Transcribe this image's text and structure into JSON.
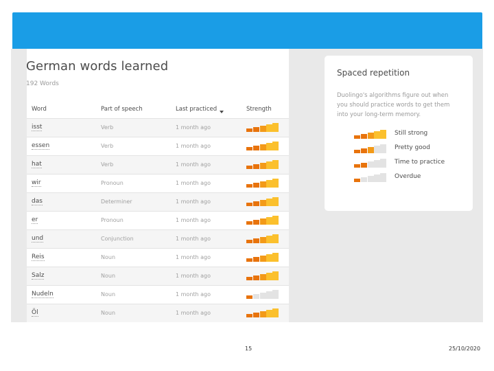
{
  "words": {
    "title": "German words learned",
    "count": "192 Words",
    "columns": {
      "word": "Word",
      "part_of_speech": "Part of speech",
      "last_practiced": "Last practiced",
      "strength": "Strength"
    },
    "rows": [
      {
        "word": "isst",
        "pos": "Verb",
        "last": "1 month ago",
        "strength": 4
      },
      {
        "word": "essen",
        "pos": "Verb",
        "last": "1 month ago",
        "strength": 4
      },
      {
        "word": "hat",
        "pos": "Verb",
        "last": "1 month ago",
        "strength": 4
      },
      {
        "word": "wir",
        "pos": "Pronoun",
        "last": "1 month ago",
        "strength": 4
      },
      {
        "word": "das",
        "pos": "Determiner",
        "last": "1 month ago",
        "strength": 4
      },
      {
        "word": "er",
        "pos": "Pronoun",
        "last": "1 month ago",
        "strength": 4
      },
      {
        "word": "und",
        "pos": "Conjunction",
        "last": "1 month ago",
        "strength": 4
      },
      {
        "word": "Reis",
        "pos": "Noun",
        "last": "1 month ago",
        "strength": 4
      },
      {
        "word": "Salz",
        "pos": "Noun",
        "last": "1 month ago",
        "strength": 4
      },
      {
        "word": "Nudeln",
        "pos": "Noun",
        "last": "1 month ago",
        "strength": 1
      },
      {
        "word": "Öl",
        "pos": "Noun",
        "last": "1 month ago",
        "strength": 4
      }
    ]
  },
  "spaced_repetition": {
    "title": "Spaced repetition",
    "description": "Duolingo's algorithms figure out when you should practice words to get them into your long-term memory.",
    "legend": [
      {
        "label": "Still strong",
        "strength": 4
      },
      {
        "label": "Pretty good",
        "strength": 3
      },
      {
        "label": "Time to practice",
        "strength": 2
      },
      {
        "label": "Overdue",
        "strength": 1
      }
    ]
  },
  "footer": {
    "page": "15",
    "date": "25/10/2020"
  },
  "colors": {
    "header_blue": "#1a9de6",
    "bar_dark": "#e8730c",
    "bar_mid": "#f39a18",
    "bar_light": "#fbc02d",
    "bar_empty": "#e3e3e3"
  }
}
